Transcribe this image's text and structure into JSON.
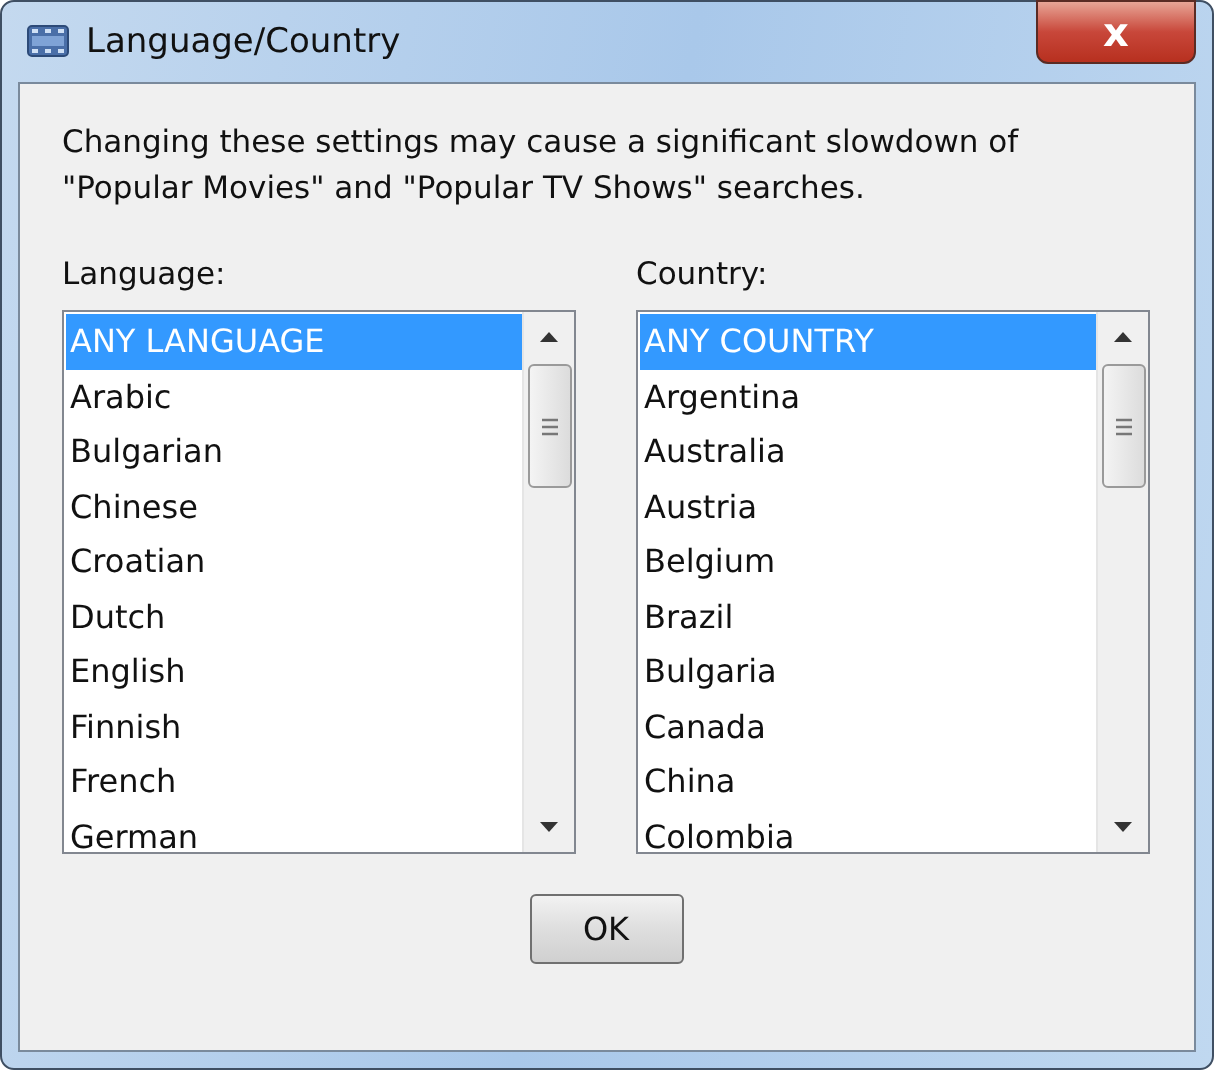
{
  "window": {
    "title": "Language/Country",
    "close_label": "x"
  },
  "message": "Changing these settings may cause a significant slowdown of \"Popular Movies\" and \"Popular TV Shows\" searches.",
  "lists": [
    {
      "label": "Language:",
      "items": [
        {
          "text": "ANY LANGUAGE",
          "selected": true
        },
        {
          "text": "Arabic",
          "selected": false
        },
        {
          "text": "Bulgarian",
          "selected": false
        },
        {
          "text": "Chinese",
          "selected": false
        },
        {
          "text": "Croatian",
          "selected": false
        },
        {
          "text": "Dutch",
          "selected": false
        },
        {
          "text": "English",
          "selected": false
        },
        {
          "text": "Finnish",
          "selected": false
        },
        {
          "text": "French",
          "selected": false
        },
        {
          "text": "German",
          "selected": false
        }
      ]
    },
    {
      "label": "Country:",
      "items": [
        {
          "text": "ANY COUNTRY",
          "selected": true
        },
        {
          "text": "Argentina",
          "selected": false
        },
        {
          "text": "Australia",
          "selected": false
        },
        {
          "text": "Austria",
          "selected": false
        },
        {
          "text": "Belgium",
          "selected": false
        },
        {
          "text": "Brazil",
          "selected": false
        },
        {
          "text": "Bulgaria",
          "selected": false
        },
        {
          "text": "Canada",
          "selected": false
        },
        {
          "text": "China",
          "selected": false
        },
        {
          "text": "Colombia",
          "selected": false
        }
      ]
    }
  ],
  "buttons": [
    "OK"
  ]
}
